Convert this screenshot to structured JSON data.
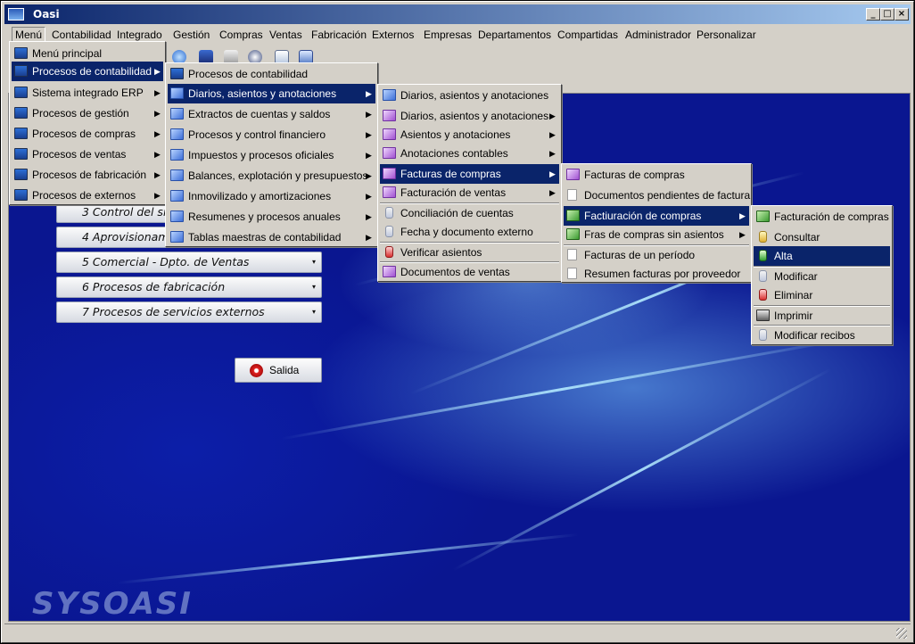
{
  "window": {
    "title": "Oasi",
    "minimize": "_",
    "maximize": "□",
    "close": "×"
  },
  "menubar": [
    "Menú",
    "Contabilidad",
    "Integrado",
    "Gestión",
    "Compras",
    "Ventas",
    "Fabricación",
    "Externos",
    "Empresas",
    "Departamentos",
    "Compartidas",
    "Administrador",
    "Personalizar"
  ],
  "modules": [
    {
      "label": "3  Control del si"
    },
    {
      "label": "4  Aprovisionam"
    },
    {
      "label": "5  Comercial - Dpto. de Ventas"
    },
    {
      "label": "6  Procesos de fabricación"
    },
    {
      "label": "7  Procesos de servicios externos"
    }
  ],
  "salida": "Salida",
  "logo": "SYSOASI",
  "menu1": [
    {
      "label": "Menú principal",
      "sub": false
    },
    {
      "label": "Procesos de contabilidad",
      "sub": true
    },
    {
      "label": "Sistema integrado ERP",
      "sub": true
    },
    {
      "label": "Procesos de gestión",
      "sub": true
    },
    {
      "label": "Procesos de compras",
      "sub": true
    },
    {
      "label": "Procesos de ventas",
      "sub": true
    },
    {
      "label": "Procesos de fabricación",
      "sub": true
    },
    {
      "label": "Procesos de externos",
      "sub": true
    }
  ],
  "menu2": [
    {
      "label": "Procesos de contabilidad",
      "sub": false
    },
    {
      "label": "Diarios, asientos y anotaciones",
      "sub": true
    },
    {
      "label": "Extractos de cuentas y saldos",
      "sub": true
    },
    {
      "label": "Procesos y control financiero",
      "sub": true
    },
    {
      "label": "Impuestos y procesos oficiales",
      "sub": true
    },
    {
      "label": "Balances, explotación y presupuestos",
      "sub": true
    },
    {
      "label": "Inmovilizado y amortizaciones",
      "sub": true
    },
    {
      "label": "Resumenes y procesos anuales",
      "sub": true
    },
    {
      "label": "Tablas maestras de contabilidad",
      "sub": true
    }
  ],
  "menu3": [
    {
      "label": "Diarios, asientos y anotaciones",
      "sub": false
    },
    {
      "label": "Diarios, asientos y anotaciones",
      "sub": true
    },
    {
      "label": "Asientos y anotaciones",
      "sub": true
    },
    {
      "label": "Anotaciones contables",
      "sub": true
    },
    {
      "label": "Facturas de compras",
      "sub": true
    },
    {
      "label": "Facturación de ventas",
      "sub": true
    },
    {
      "label": "Conciliación de cuentas",
      "sub": false
    },
    {
      "label": "Fecha y documento externo",
      "sub": false
    },
    {
      "label": "Verificar asientos",
      "sub": false
    },
    {
      "label": "Documentos de ventas",
      "sub": false
    }
  ],
  "menu4": [
    {
      "label": "Facturas de compras",
      "sub": false
    },
    {
      "label": "Documentos pendientes de factura",
      "sub": false
    },
    {
      "label": "Factiuración de compras",
      "sub": true
    },
    {
      "label": "Fras de compras sin asientos",
      "sub": true
    },
    {
      "label": "Facturas de un período",
      "sub": false
    },
    {
      "label": "Resumen facturas por proveedor",
      "sub": false
    }
  ],
  "menu5": [
    {
      "label": "Facturación de compras"
    },
    {
      "label": "Consultar"
    },
    {
      "label": "Alta"
    },
    {
      "label": "Modificar"
    },
    {
      "label": "Eliminar"
    },
    {
      "label": "Imprimir"
    },
    {
      "label": "Modificar recibos"
    }
  ],
  "submenu_arrow": "▶",
  "dropdown_arrow": "▾"
}
